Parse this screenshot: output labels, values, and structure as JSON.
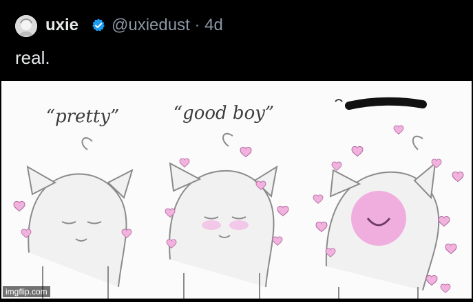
{
  "tweet": {
    "author_name": "uxie",
    "handle": "@uxiedust",
    "separator": "·",
    "time": "4d",
    "text": "real.",
    "verified_badge": "verified-check-icon",
    "avatar": "avatar"
  },
  "media": {
    "captions": [
      "“pretty”",
      "“good boy”"
    ],
    "censored_caption_icon": "censored-scribble",
    "watermark": "imgflip.com"
  },
  "colors": {
    "background": "#000000",
    "name_text": "#e7e9ea",
    "handle_text": "#8b98a5",
    "verified_blue": "#1d9bf0",
    "heart_pink": "#e9a6d6",
    "blush_pink": "#f3b8e3"
  }
}
